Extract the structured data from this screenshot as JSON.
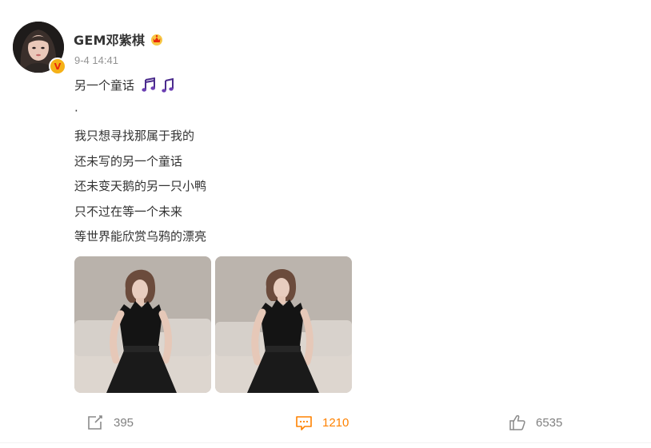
{
  "post": {
    "user": {
      "name": "GEM邓紫棋",
      "verified_badge": "V",
      "vip_icon": "crown-icon",
      "verified_color": "#f5b117",
      "timestamp": "9-4 14:41"
    },
    "text_lines": [
      "另一个童话",
      "·",
      "我只想寻找那属于我的",
      "还未写的另一个童话",
      "还未变天鹅的另一只小鸭",
      "只不过在等一个未来",
      "等世界能欣赏乌鸦的漂亮"
    ],
    "title_emojis": [
      "music-notes-emoji",
      "music-note-emoji"
    ],
    "images": [
      {
        "description": "photo-woman-black-feather-top-1"
      },
      {
        "description": "photo-woman-black-feather-top-2"
      }
    ],
    "actions": {
      "repost": {
        "icon": "share-icon",
        "count": "395"
      },
      "comment": {
        "icon": "comment-icon",
        "count": "1210",
        "color": "#ff8200"
      },
      "like": {
        "icon": "thumbs-up-icon",
        "count": "6535"
      }
    }
  }
}
